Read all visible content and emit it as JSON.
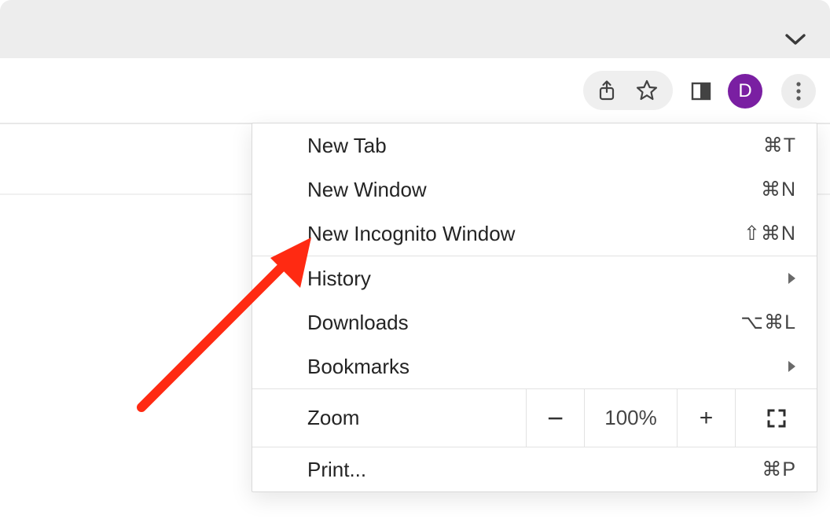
{
  "profile": {
    "initial": "D",
    "accent": "#7a1fa2"
  },
  "menu": {
    "new_tab": {
      "label": "New Tab",
      "shortcut": "⌘T"
    },
    "new_window": {
      "label": "New Window",
      "shortcut": "⌘N"
    },
    "new_incognito": {
      "label": "New Incognito Window",
      "shortcut": "⇧⌘N"
    },
    "history": {
      "label": "History"
    },
    "downloads": {
      "label": "Downloads",
      "shortcut": "⌥⌘L"
    },
    "bookmarks": {
      "label": "Bookmarks"
    },
    "zoom": {
      "label": "Zoom",
      "value": "100%"
    },
    "print": {
      "label": "Print...",
      "shortcut": "⌘P"
    }
  },
  "annotation": {
    "points_to": "new_incognito"
  }
}
